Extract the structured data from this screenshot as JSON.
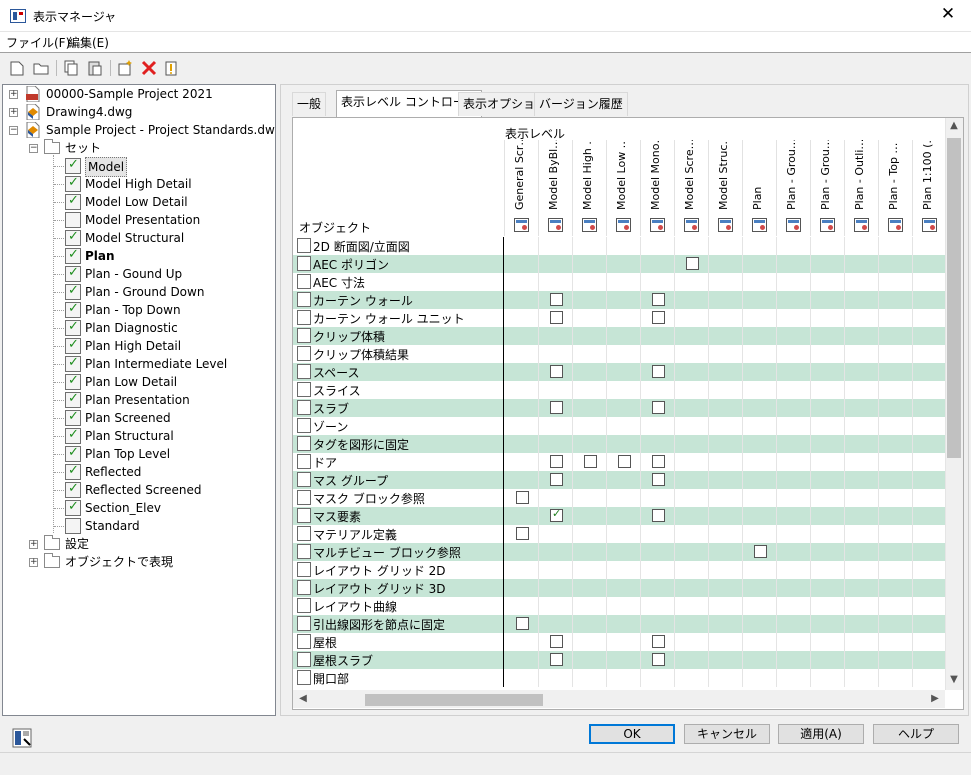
{
  "window": {
    "title": "表示マネージャ"
  },
  "menu": [
    "ファイル(F)",
    "編集(E)"
  ],
  "tree": {
    "projects": [
      {
        "label": "00000-Sample Project 2021",
        "icon": "pdf-file-icon"
      },
      {
        "label": "Drawing4.dwg",
        "icon": "dwg-file-icon"
      },
      {
        "label": "Sample Project - Project Standards.dwg",
        "icon": "dwg-file-icon"
      }
    ],
    "set_folder": "セット",
    "sets": [
      "Model",
      "Model High Detail",
      "Model Low Detail",
      "Model Presentation",
      "Model Structural",
      "Plan",
      "Plan - Gound Up",
      "Plan - Ground Down",
      "Plan - Top Down",
      "Plan Diagnostic",
      "Plan High Detail",
      "Plan Intermediate Level",
      "Plan Low Detail",
      "Plan Presentation",
      "Plan Screened",
      "Plan Structural",
      "Plan Top Level",
      "Reflected",
      "Reflected Screened",
      "Section_Elev",
      "Standard"
    ],
    "sets_checked": [
      true,
      true,
      true,
      false,
      true,
      true,
      true,
      true,
      true,
      true,
      true,
      true,
      true,
      true,
      true,
      true,
      true,
      true,
      true,
      true,
      false
    ],
    "selected": "Model",
    "bold": "Plan",
    "folders": [
      "設定",
      "オブジェクトで表現"
    ]
  },
  "tabs": [
    "一般",
    "表示レベル コントロール",
    "表示オプション",
    "バージョン履歴"
  ],
  "active_tab": 1,
  "grid": {
    "display_level_label": "表示レベル",
    "object_label": "オブジェクト",
    "columns": [
      "General Scr…",
      "Model ByBl…",
      "Model High …",
      "Model Low …",
      "Model Mono…",
      "Model Scre…",
      "Model Struc…",
      "Plan",
      "Plan - Grou…",
      "Plan - Grou…",
      "Plan - Outli…",
      "Plan - Top …",
      "Plan 1:100 (…"
    ],
    "rows": [
      {
        "label": "2D 断面図/立面図",
        "cells": []
      },
      {
        "label": "AEC ポリゴン",
        "cells": [
          {
            "col": 5,
            "checked": false
          }
        ]
      },
      {
        "label": "AEC 寸法",
        "cells": []
      },
      {
        "label": "カーテン ウォール",
        "cells": [
          {
            "col": 1,
            "checked": false
          },
          {
            "col": 4,
            "checked": false
          }
        ]
      },
      {
        "label": "カーテン ウォール ユニット",
        "cells": [
          {
            "col": 1,
            "checked": false
          },
          {
            "col": 4,
            "checked": false
          }
        ]
      },
      {
        "label": "クリップ体積",
        "cells": []
      },
      {
        "label": "クリップ体積結果",
        "cells": []
      },
      {
        "label": "スペース",
        "cells": [
          {
            "col": 1,
            "checked": false
          },
          {
            "col": 4,
            "checked": false
          }
        ]
      },
      {
        "label": "スライス",
        "cells": []
      },
      {
        "label": "スラブ",
        "cells": [
          {
            "col": 1,
            "checked": false
          },
          {
            "col": 4,
            "checked": false
          }
        ]
      },
      {
        "label": "ゾーン",
        "cells": []
      },
      {
        "label": "タグを図形に固定",
        "cells": []
      },
      {
        "label": "ドア",
        "cells": [
          {
            "col": 1,
            "checked": false
          },
          {
            "col": 2,
            "checked": false
          },
          {
            "col": 3,
            "checked": false
          },
          {
            "col": 4,
            "checked": false
          }
        ]
      },
      {
        "label": "マス グループ",
        "cells": [
          {
            "col": 1,
            "checked": false
          },
          {
            "col": 4,
            "checked": false
          }
        ]
      },
      {
        "label": "マスク ブロック参照",
        "cells": [
          {
            "col": 0,
            "checked": false
          }
        ]
      },
      {
        "label": "マス要素",
        "cells": [
          {
            "col": 1,
            "checked": true
          },
          {
            "col": 4,
            "checked": false
          }
        ]
      },
      {
        "label": "マテリアル定義",
        "cells": [
          {
            "col": 0,
            "checked": false
          }
        ]
      },
      {
        "label": "マルチビュー ブロック参照",
        "cells": [
          {
            "col": 7,
            "checked": false
          }
        ]
      },
      {
        "label": "レイアウト グリッド 2D",
        "cells": []
      },
      {
        "label": "レイアウト グリッド 3D",
        "cells": []
      },
      {
        "label": "レイアウト曲線",
        "cells": []
      },
      {
        "label": "引出線図形を節点に固定",
        "cells": [
          {
            "col": 0,
            "checked": false
          }
        ]
      },
      {
        "label": "屋根",
        "cells": [
          {
            "col": 1,
            "checked": false
          },
          {
            "col": 4,
            "checked": false
          }
        ]
      },
      {
        "label": "屋根スラブ",
        "cells": [
          {
            "col": 1,
            "checked": false
          },
          {
            "col": 4,
            "checked": false
          }
        ]
      },
      {
        "label": "開口部",
        "cells": []
      }
    ]
  },
  "buttons": {
    "ok": "OK",
    "cancel": "キャンセル",
    "apply": "適用(A)",
    "help": "ヘルプ"
  },
  "colors": {
    "row_alt": "#c6e5d6",
    "accent": "#0078d7"
  }
}
